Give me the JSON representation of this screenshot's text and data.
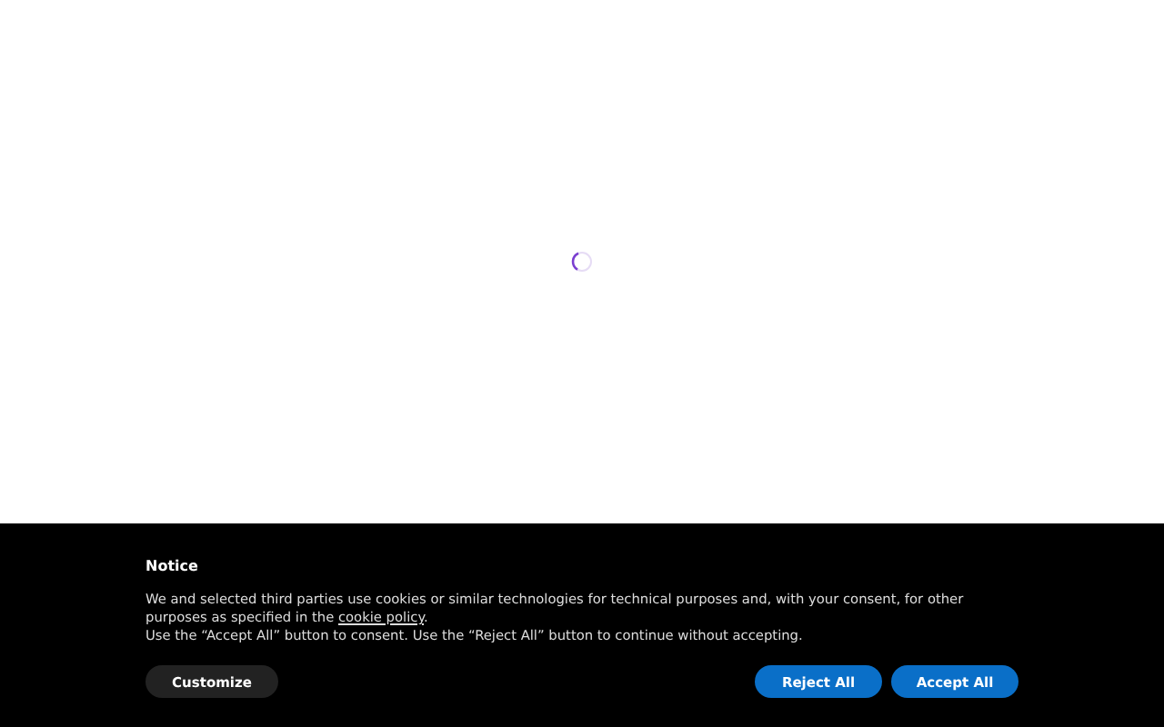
{
  "loader": {
    "kind": "spinner"
  },
  "notice": {
    "title": "Notice",
    "text_before": "We and selected third parties use cookies or similar technologies for technical purposes and, with your consent, for other purposes as specified in the ",
    "link": "cookie policy",
    "text_after": ".",
    "text_2": "Use the “Accept All” button to consent. Use the “Reject All” button to continue without accepting.",
    "buttons": [
      {
        "label": "Customize",
        "kind": "secondary"
      },
      {
        "label": "Reject All",
        "kind": "primary"
      },
      {
        "label": "Accept All",
        "kind": "primary"
      }
    ]
  }
}
